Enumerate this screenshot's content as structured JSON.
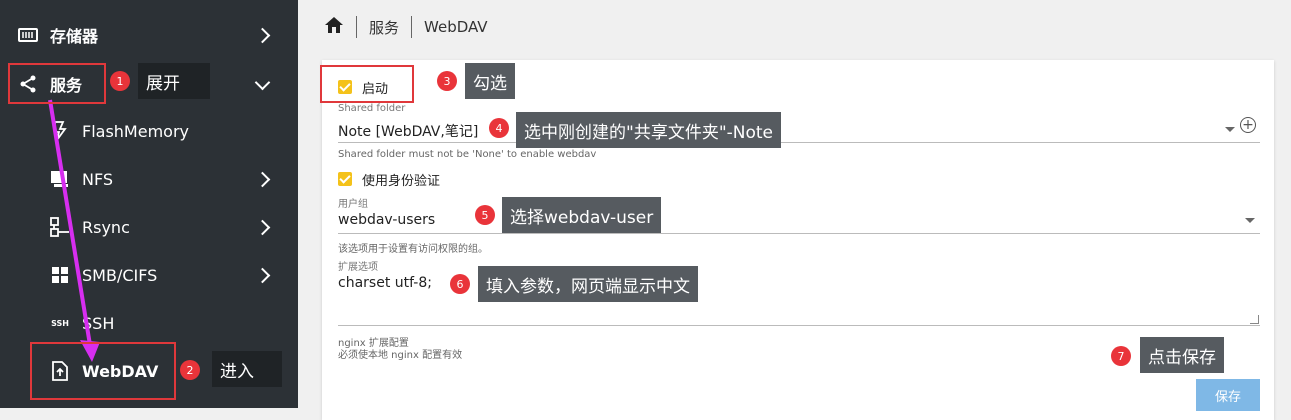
{
  "sidebar": {
    "items": [
      {
        "label": "存储器",
        "icon": "storage-icon"
      },
      {
        "label": "服务",
        "icon": "share-icon"
      },
      {
        "label": "FlashMemory",
        "icon": "flash-icon"
      },
      {
        "label": "NFS",
        "icon": "monitor-icon"
      },
      {
        "label": "Rsync",
        "icon": "rsync-icon"
      },
      {
        "label": "SMB/CIFS",
        "icon": "windows-icon"
      },
      {
        "label": "SSH",
        "icon": "ssh-icon"
      },
      {
        "label": "WebDAV",
        "icon": "upload-file-icon"
      }
    ]
  },
  "breadcrumb": {
    "home_icon": "home-icon",
    "items": [
      "服务",
      "WebDAV"
    ]
  },
  "form": {
    "enable_label": "启动",
    "shared_folder": {
      "label": "Shared folder",
      "value": "Note [WebDAV,笔记]",
      "helper": "Shared folder must not be 'None' to enable webdav"
    },
    "auth_label": "使用身份验证",
    "user_group": {
      "label": "用户组",
      "value": "webdav-users",
      "helper": "该选项用于设置有访问权限的组。"
    },
    "ext_options": {
      "label": "扩展选项",
      "value": "charset utf-8;",
      "helper_1": "nginx 扩展配置",
      "helper_2": "必须使本地 nginx 配置有效"
    },
    "save_label": "保存"
  },
  "annotations": [
    {
      "num": "1",
      "text": "展开"
    },
    {
      "num": "2",
      "text": "进入"
    },
    {
      "num": "3",
      "text": "勾选"
    },
    {
      "num": "4",
      "text": "选中刚创建的\"共享文件夹\"-Note"
    },
    {
      "num": "5",
      "text": "选择webdav-user"
    },
    {
      "num": "6",
      "text": "填入参数，网页端显示中文"
    },
    {
      "num": "7",
      "text": "点击保存"
    }
  ],
  "colors": {
    "sidebar_bg": "#2c3136",
    "annotation_red": "#e0383b",
    "arrow": "#d72ef0",
    "checkbox": "#f4c21a",
    "save_btn": "#7fb8e6"
  }
}
